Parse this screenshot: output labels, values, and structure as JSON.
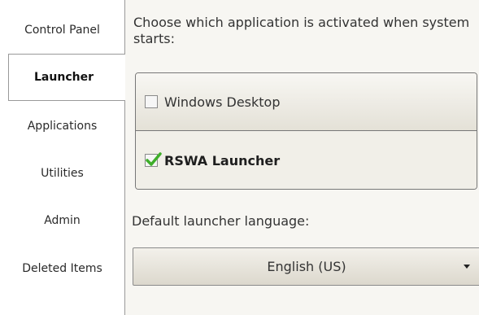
{
  "sidebar": {
    "items": [
      {
        "label": "Control Panel"
      },
      {
        "label": "Launcher"
      },
      {
        "label": "Applications"
      },
      {
        "label": "Utilities"
      },
      {
        "label": "Admin"
      },
      {
        "label": "Deleted Items"
      }
    ],
    "active": "Launcher"
  },
  "main": {
    "heading": "Choose which application is activated when system starts:",
    "options": [
      {
        "label": "Windows Desktop",
        "checked": false
      },
      {
        "label": "RSWA Launcher",
        "checked": true
      }
    ],
    "language_label": "Default launcher language:",
    "language_value": "English (US)"
  },
  "colors": {
    "check": "#3fae2a",
    "panel_bg": "#f7f6f2"
  }
}
